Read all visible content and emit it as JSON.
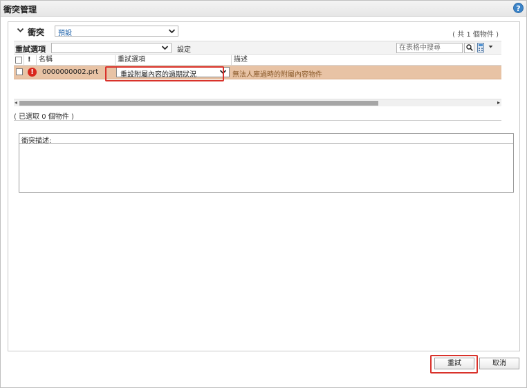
{
  "window": {
    "title": "衝突管理",
    "help_icon": "?"
  },
  "conflict_section": {
    "label": "衝突",
    "view_select_value": "預設",
    "object_count": "( 共 1 個物件 )"
  },
  "toolbar": {
    "retry_options_label": "重試選項",
    "retry_options_value": "",
    "settings_label": "設定",
    "search_placeholder": "在表格中搜尋"
  },
  "table": {
    "columns": [
      "!",
      "名稱",
      "重試選項",
      "描述"
    ],
    "rows": [
      {
        "name": "0000000002.prt",
        "retry_option": "重設附屬內容的過期狀況",
        "description": "無法人庫過時的附屬內容物件",
        "status_icon": "error-icon"
      }
    ]
  },
  "status": {
    "selected_text": "( 已選取 0 個物件 )"
  },
  "description_panel": {
    "label": "衝突描述:"
  },
  "footer": {
    "retry_button": "重試",
    "cancel_button": "取消"
  },
  "colors": {
    "row_highlight": "#e8c3a5",
    "annotation_red": "#d9322b",
    "error_red": "#d9261c",
    "link_blue": "#1a5fa8"
  }
}
